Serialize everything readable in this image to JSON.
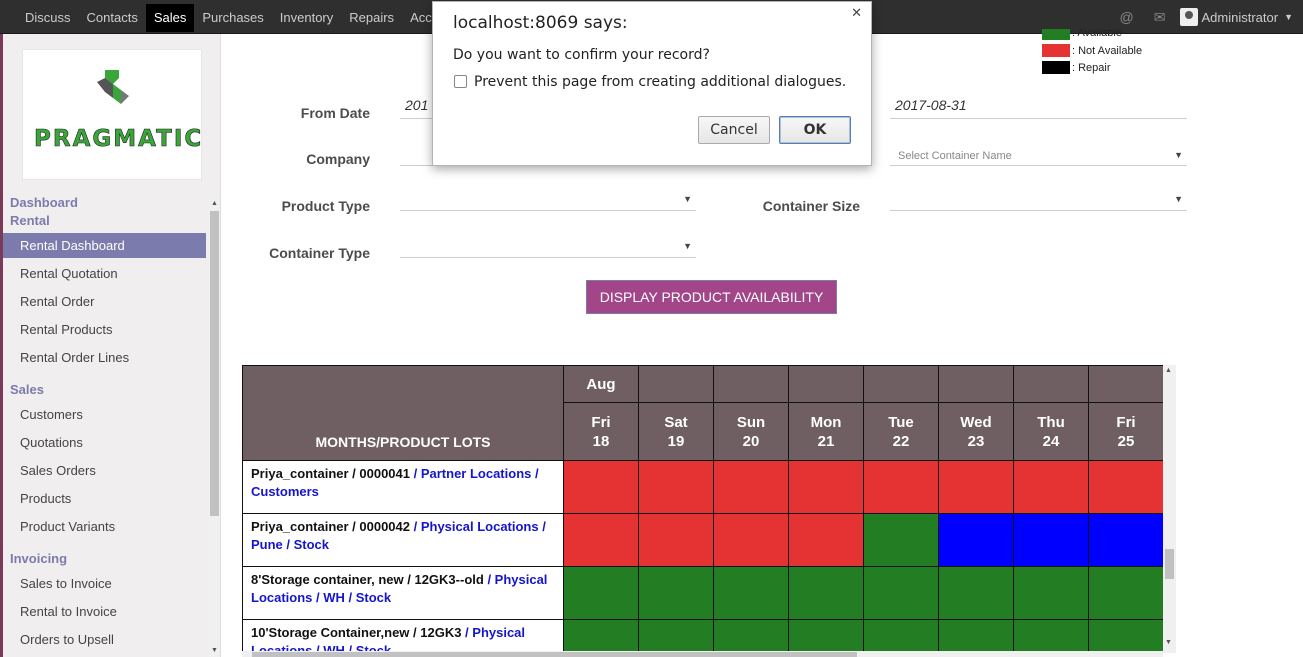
{
  "topbar": {
    "menu": [
      "Discuss",
      "Contacts",
      "Sales",
      "Purchases",
      "Inventory",
      "Repairs",
      "Acc"
    ],
    "active": "Sales",
    "user": "Administrator"
  },
  "sidebar": {
    "logo_text": "PRAGMATIC",
    "sections": [
      {
        "title": "Dashboard",
        "items": []
      },
      {
        "title": "Rental",
        "items": [
          "Rental Dashboard",
          "Rental Quotation",
          "Rental Order",
          "Rental Products",
          "Rental Order Lines"
        ]
      },
      {
        "title": "Sales",
        "items": [
          "Customers",
          "Quotations",
          "Sales Orders",
          "Products",
          "Product Variants"
        ]
      },
      {
        "title": "Invoicing",
        "items": [
          "Sales to Invoice",
          "Rental to Invoice",
          "Orders to Upsell"
        ]
      }
    ],
    "active_item": "Rental Dashboard"
  },
  "legend": [
    {
      "label": ": Available",
      "color": "#237d23"
    },
    {
      "label": ": Not Available",
      "color": "#e53333"
    },
    {
      "label": ": Repair",
      "color": "#000000"
    }
  ],
  "form": {
    "from_date_label": "From Date",
    "from_date_value": "201",
    "to_date_value": "2017-08-31",
    "company_label": "Company",
    "container_name_placeholder": "Select Container Name",
    "product_type_label": "Product Type",
    "container_size_label": "Container Size",
    "container_type_label": "Container Type",
    "display_button": "DISPLAY PRODUCT AVAILABILITY"
  },
  "grid": {
    "corner_label": "MONTHS/PRODUCT LOTS",
    "month": "Aug",
    "days": [
      {
        "dow": "Fri",
        "day": "18"
      },
      {
        "dow": "Sat",
        "day": "19"
      },
      {
        "dow": "Sun",
        "day": "20"
      },
      {
        "dow": "Mon",
        "day": "21"
      },
      {
        "dow": "Tue",
        "day": "22"
      },
      {
        "dow": "Wed",
        "day": "23"
      },
      {
        "dow": "Thu",
        "day": "24"
      },
      {
        "dow": "Fri",
        "day": "25"
      }
    ],
    "rows": [
      {
        "lot": "Priya_container / 0000041",
        "location": " / Partner Locations / Customers",
        "cells": [
          "#e53333",
          "#e53333",
          "#e53333",
          "#e53333",
          "#e53333",
          "#e53333",
          "#e53333",
          "#e53333"
        ]
      },
      {
        "lot": "Priya_container / 0000042",
        "location": " / Physical Locations / Pune / Stock",
        "cells": [
          "#e53333",
          "#e53333",
          "#e53333",
          "#e53333",
          "#237d23",
          "#0000ff",
          "#0000ff",
          "#0000ff"
        ]
      },
      {
        "lot": "8'Storage container, new / 12GK3--old",
        "location": " / Physical Locations / WH / Stock",
        "cells": [
          "#237d23",
          "#237d23",
          "#237d23",
          "#237d23",
          "#237d23",
          "#237d23",
          "#237d23",
          "#237d23"
        ]
      },
      {
        "lot": "10'Storage Container,new / 12GK3",
        "location": " / Physical Locations / WH / Stock",
        "cells": [
          "#237d23",
          "#237d23",
          "#237d23",
          "#237d23",
          "#237d23",
          "#237d23",
          "#237d23",
          "#237d23"
        ]
      }
    ]
  },
  "dialog": {
    "title": "localhost:8069 says:",
    "message": "Do you want to confirm your record?",
    "checkbox_label": "Prevent this page from creating additional dialogues.",
    "cancel": "Cancel",
    "ok": "OK"
  }
}
